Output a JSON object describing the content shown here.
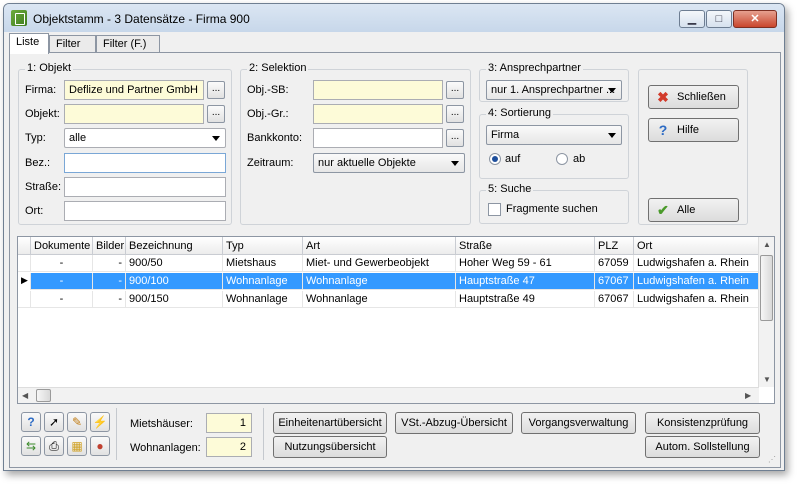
{
  "window": {
    "title": "Objektstamm - 3 Datensätze - Firma 900",
    "controls": {
      "minimize": "▁",
      "maximize": "□",
      "close": "✕"
    }
  },
  "tabs": [
    {
      "label": "Liste"
    },
    {
      "label": "Filter"
    },
    {
      "label": "Filter (F.)"
    }
  ],
  "objekt": {
    "title": "1: Objekt",
    "firma_label": "Firma:",
    "firma_value": "Deflize und Partner GmbH",
    "objekt_label": "Objekt:",
    "objekt_value": "",
    "typ_label": "Typ:",
    "typ_value": "alle",
    "bez_label": "Bez.:",
    "bez_value": "",
    "strasse_label": "Straße:",
    "strasse_value": "",
    "ort_label": "Ort:",
    "ort_value": ""
  },
  "selektion": {
    "title": "2: Selektion",
    "objsb_label": "Obj.-SB:",
    "objsb_value": "",
    "objgr_label": "Obj.-Gr.:",
    "objgr_value": "",
    "bankkonto_label": "Bankkonto:",
    "bankkonto_value": "",
    "zeitraum_label": "Zeitraum:",
    "zeitraum_value": "nur aktuelle Objekte"
  },
  "ansprechpartner": {
    "title": "3: Ansprechpartner",
    "value": "nur 1. Ansprechpartner ..."
  },
  "sortierung": {
    "title": "4: Sortierung",
    "value": "Firma",
    "auf": "auf",
    "ab": "ab"
  },
  "suche": {
    "title": "5: Suche",
    "fragmente": "Fragmente suchen"
  },
  "actions": {
    "schliessen": "Schließen",
    "hilfe": "Hilfe",
    "alle": "Alle"
  },
  "ellipsis": "...",
  "table": {
    "columns": [
      "Dokumente",
      "Bilder",
      "Bezeichnung",
      "Typ",
      "Art",
      "Straße",
      "PLZ",
      "Ort"
    ],
    "rows": [
      {
        "marker": "",
        "dokumente": "-",
        "bilder": "-",
        "bezeichnung": "900/50",
        "typ": "Mietshaus",
        "art": "Miet- und Gewerbeobjekt",
        "strasse": "Hoher Weg 59 - 61",
        "plz": "67059",
        "ort": "Ludwigshafen a. Rhein"
      },
      {
        "marker": "▶",
        "dokumente": "-",
        "bilder": "-",
        "bezeichnung": "900/100",
        "typ": "Wohnanlage",
        "art": "Wohnanlage",
        "strasse": "Hauptstraße 47",
        "plz": "67067",
        "ort": "Ludwigshafen a. Rhein"
      },
      {
        "marker": "",
        "dokumente": "-",
        "bilder": "-",
        "bezeichnung": "900/150",
        "typ": "Wohnanlage",
        "art": "Wohnanlage",
        "strasse": "Hauptstraße 49",
        "plz": "67067",
        "ort": "Ludwigshafen a. Rhein"
      }
    ]
  },
  "counts": {
    "mietshaeuser_label": "Mietshäuser:",
    "mietshaeuser_value": "1",
    "wohnanlagen_label": "Wohnanlagen:",
    "wohnanlagen_value": "2"
  },
  "bottom_buttons": {
    "einheitenart": "Einheitenartübersicht",
    "vst": "VSt.-Abzug-Übersicht",
    "vorgang": "Vorgangsverwaltung",
    "konsistenz": "Konsistenzprüfung",
    "nutzung": "Nutzungsübersicht",
    "sollstellung": "Autom. Sollstellung"
  },
  "colors": {
    "selection": "#3399ff",
    "required_field": "#fdfbd8"
  }
}
